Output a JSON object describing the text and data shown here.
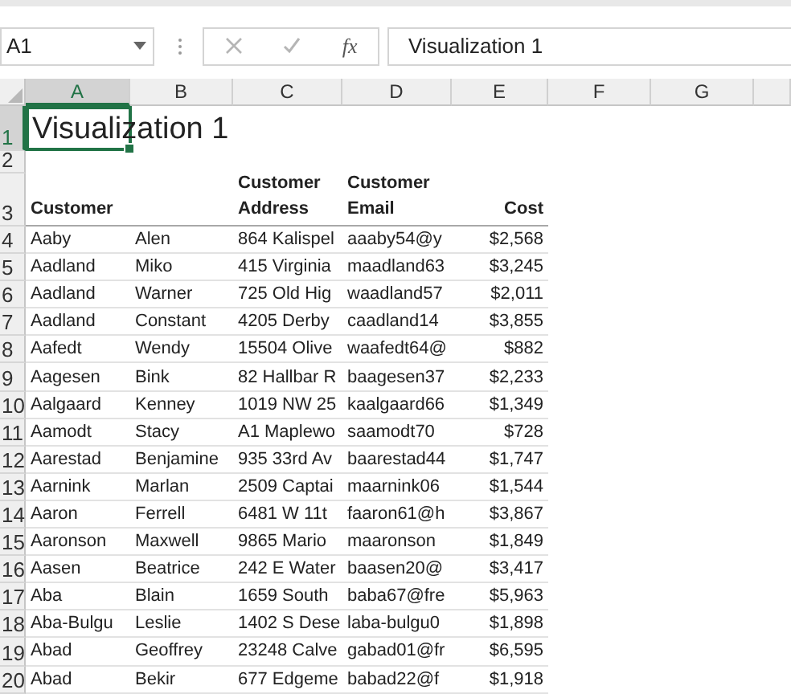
{
  "name_box": "A1",
  "formula_bar": {
    "fx": "fx",
    "value": "Visualization 1"
  },
  "columns": [
    {
      "label": "A",
      "selected": true
    },
    {
      "label": "B",
      "selected": false
    },
    {
      "label": "C",
      "selected": false
    },
    {
      "label": "D",
      "selected": false
    },
    {
      "label": "E",
      "selected": false
    },
    {
      "label": "F",
      "selected": false
    },
    {
      "label": "G",
      "selected": false
    }
  ],
  "rows": [
    {
      "kind": "title",
      "number": "1",
      "selected": true,
      "text": "Visualization 1"
    },
    {
      "kind": "blank",
      "number": "2",
      "selected": false
    },
    {
      "kind": "header",
      "number": "3",
      "selected": false,
      "customer": "Customer",
      "address": "Customer Address",
      "email": "Customer Email",
      "cost": "Cost"
    },
    {
      "kind": "data",
      "number": "4",
      "selected": false,
      "last": "Aaby",
      "first": "Alen",
      "address": "864 Kalispel",
      "email": "aaaby54@y",
      "cost": "$2,568"
    },
    {
      "kind": "data",
      "number": "5",
      "selected": false,
      "last": "Aadland",
      "first": "Miko",
      "address": "415 Virginia",
      "email": "maadland63",
      "cost": "$3,245"
    },
    {
      "kind": "data",
      "number": "6",
      "selected": false,
      "last": "Aadland",
      "first": "Warner",
      "address": "725 Old Hig",
      "email": "waadland57",
      "cost": "$2,011"
    },
    {
      "kind": "data",
      "number": "7",
      "selected": false,
      "last": "Aadland",
      "first": "Constant",
      "address": "4205 Derby",
      "email": "caadland14",
      "cost": "$3,855"
    },
    {
      "kind": "data",
      "number": "8",
      "selected": false,
      "last": "Aafedt",
      "first": "Wendy",
      "address": "15504 Olive",
      "email": "waafedt64@",
      "cost": "$882"
    },
    {
      "kind": "data",
      "number": "9",
      "selected": false,
      "last": "Aagesen",
      "first": "Bink",
      "address": "82 Hallbar R",
      "email": "baagesen37",
      "cost": "$2,233"
    },
    {
      "kind": "data",
      "number": "10",
      "selected": false,
      "last": "Aalgaard",
      "first": "Kenney",
      "address": "1019 NW 25",
      "email": "kaalgaard66",
      "cost": "$1,349"
    },
    {
      "kind": "data",
      "number": "11",
      "selected": false,
      "last": "Aamodt",
      "first": "Stacy",
      "address": "A1 Maplewo",
      "email": "saamodt70",
      "cost": "$728"
    },
    {
      "kind": "data",
      "number": "12",
      "selected": false,
      "last": "Aarestad",
      "first": "Benjamine",
      "address": "935 33rd Av",
      "email": "baarestad44",
      "cost": "$1,747"
    },
    {
      "kind": "data",
      "number": "13",
      "selected": false,
      "last": "Aarnink",
      "first": "Marlan",
      "address": "2509 Captai",
      "email": "maarnink06",
      "cost": "$1,544"
    },
    {
      "kind": "data",
      "number": "14",
      "selected": false,
      "last": "Aaron",
      "first": "Ferrell",
      "address": "6481 W 11t",
      "email": "faaron61@h",
      "cost": "$3,867"
    },
    {
      "kind": "data",
      "number": "15",
      "selected": false,
      "last": "Aaronson",
      "first": "Maxwell",
      "address": "9865 Mario",
      "email": "maaronson",
      "cost": "$1,849"
    },
    {
      "kind": "data",
      "number": "16",
      "selected": false,
      "last": "Aasen",
      "first": "Beatrice",
      "address": "242 E Water",
      "email": "baasen20@",
      "cost": "$3,417"
    },
    {
      "kind": "data",
      "number": "17",
      "selected": false,
      "last": "Aba",
      "first": "Blain",
      "address": "1659 South",
      "email": "baba67@fre",
      "cost": "$5,963"
    },
    {
      "kind": "data",
      "number": "18",
      "selected": false,
      "last": "Aba-Bulgu",
      "first": "Leslie",
      "address": "1402 S Dese",
      "email": "laba-bulgu0",
      "cost": "$1,898"
    },
    {
      "kind": "data",
      "number": "19",
      "selected": false,
      "last": "Abad",
      "first": "Geoffrey",
      "address": "23248 Calve",
      "email": "gabad01@fr",
      "cost": "$6,595"
    },
    {
      "kind": "data",
      "number": "20",
      "selected": false,
      "last": "Abad",
      "first": "Bekir",
      "address": "677 Edgeme",
      "email": "babad22@f",
      "cost": "$1,918"
    }
  ]
}
